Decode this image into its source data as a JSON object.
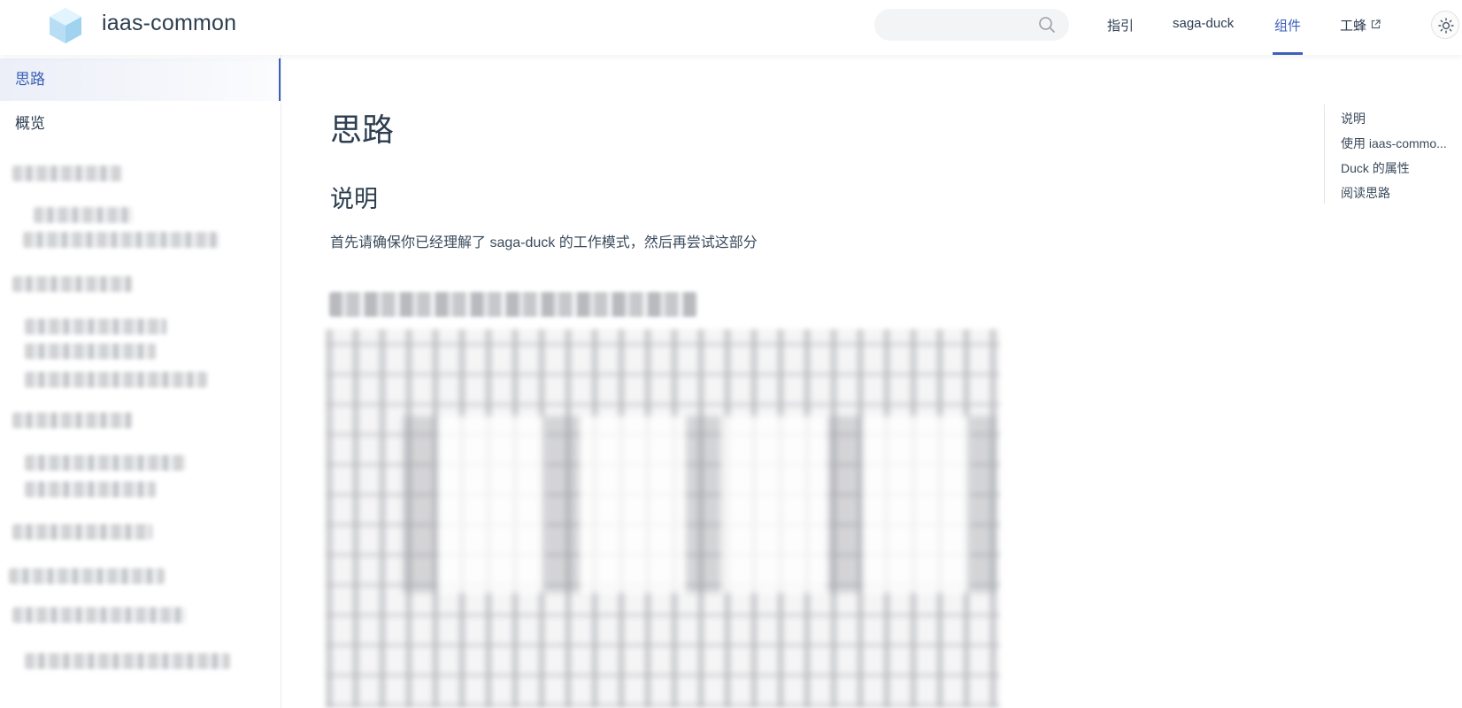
{
  "header": {
    "site_title": "iaas-common",
    "search": {
      "value": "",
      "placeholder": ""
    },
    "nav": [
      {
        "label": "指引"
      },
      {
        "label": "saga-duck"
      },
      {
        "label": "组件",
        "active": true
      },
      {
        "label": "工蜂",
        "external": true
      }
    ],
    "icons": {
      "logo": "cube-logo-icon",
      "search": "search-icon",
      "external": "external-link-icon",
      "theme": "sun-icon"
    }
  },
  "sidebar": {
    "items": [
      {
        "label": "思路",
        "active": true
      },
      {
        "label": "概览"
      }
    ]
  },
  "main": {
    "title": "思路",
    "section_heading": "说明",
    "intro": "首先请确保你已经理解了 saga-duck 的工作模式，然后再尝试这部分"
  },
  "outline": {
    "items": [
      {
        "label": "说明"
      },
      {
        "label": "使用 iaas-commo..."
      },
      {
        "label": "Duck 的属性"
      },
      {
        "label": "阅读思路"
      }
    ]
  },
  "colors": {
    "accent": "#3d60b8",
    "text": "#2c3e50",
    "divider": "#eaecef"
  }
}
